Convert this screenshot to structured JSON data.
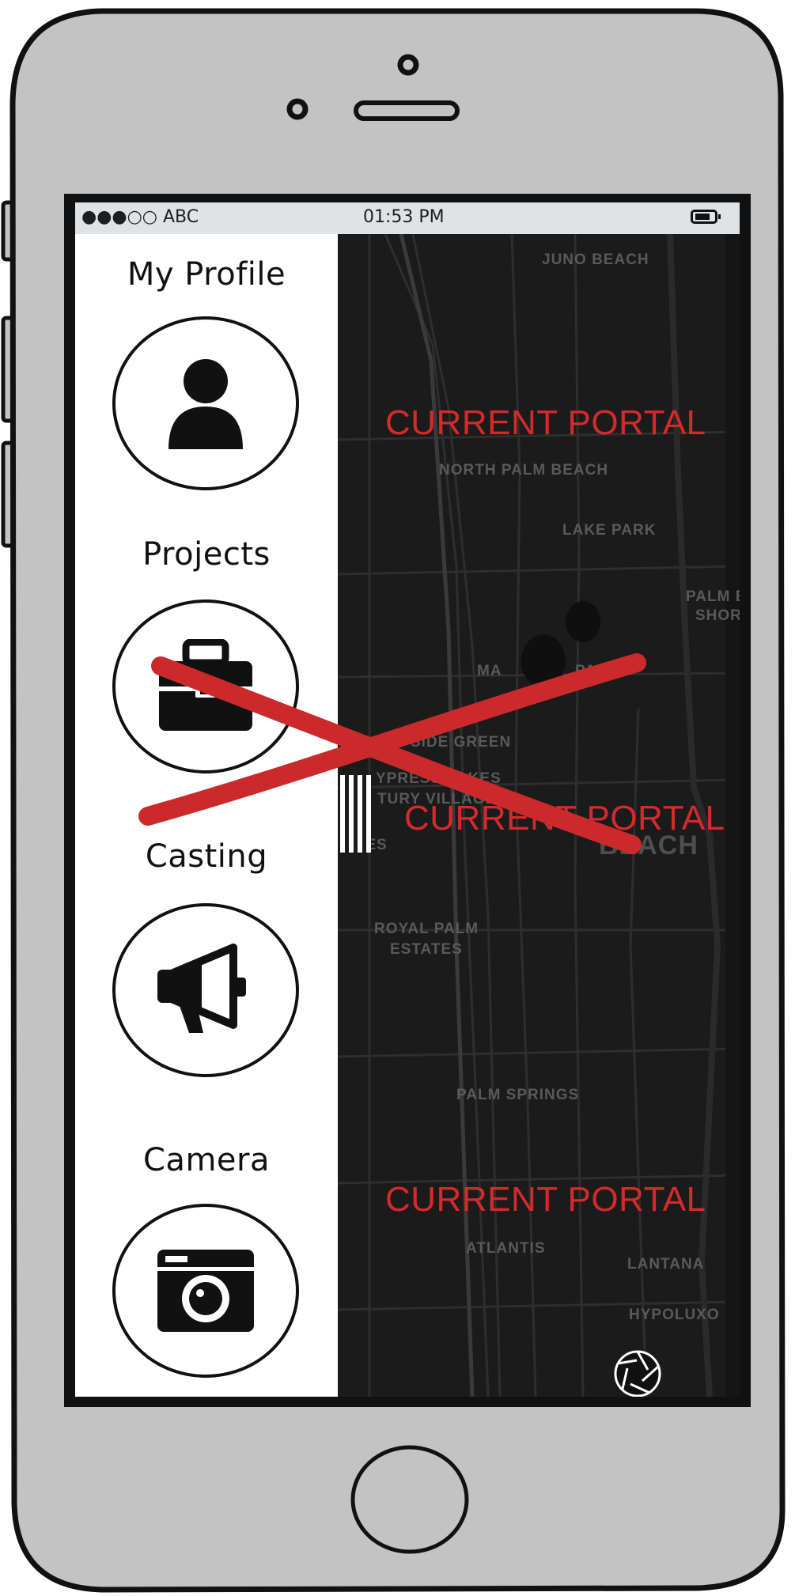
{
  "status_bar": {
    "carrier": "●●●○○ ABC",
    "time": "01:53 PM",
    "battery_icon": "battery-icon"
  },
  "sidebar": {
    "items": [
      {
        "label": "My Profile",
        "icon": "user-icon"
      },
      {
        "label": "Projects",
        "icon": "briefcase-icon",
        "crossed_out": true
      },
      {
        "label": "Casting",
        "icon": "megaphone-icon"
      },
      {
        "label": "Camera",
        "icon": "camera-icon"
      }
    ]
  },
  "map": {
    "places": [
      "JUNO BEACH",
      "NORTH PALM BEACH",
      "LAKE PARK",
      "PALM BE",
      "SHOR",
      "MA",
      "PARK",
      "SIDE GREEN",
      "YPRESS LAKES",
      "TURY VILLAGE",
      "AKES",
      "ROYAL PALM",
      "ESTATES",
      "PALM SPRINGS",
      "ATLANTIS",
      "LANTANA",
      "HYPOLUXO",
      "BEACH"
    ],
    "portal_labels": [
      "CURRENT PORTAL",
      "CURRENT PORTAL",
      "CURRENT PORTAL"
    ]
  },
  "colors": {
    "accent_red": "#d62a2a",
    "phone_body": "#c3c3c3",
    "map_bg": "#1b1b1b"
  }
}
